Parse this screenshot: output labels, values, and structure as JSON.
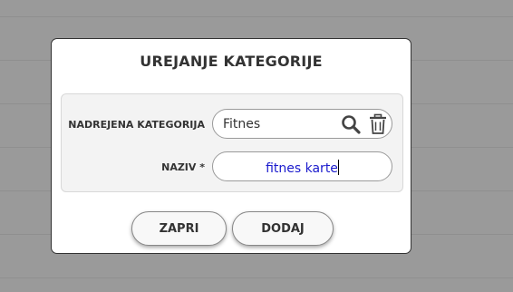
{
  "dialog": {
    "title": "UREJANJE KATEGORIJE",
    "fields": {
      "parent_category": {
        "label": "NADREJENA KATEGORIJA",
        "value": "Fitnes",
        "icons": [
          "search-icon",
          "trash-icon"
        ]
      },
      "name": {
        "label": "NAZIV *",
        "value": "fitnes karte"
      }
    },
    "buttons": {
      "close_label": "ZAPRI",
      "add_label": "DODAJ"
    }
  },
  "colors": {
    "overlay": "#9a9a9a",
    "dialog_bg": "#ffffff",
    "panel_bg": "#f3f3f3",
    "input_text_blue": "#1a1acd",
    "text_dark": "#333333"
  }
}
